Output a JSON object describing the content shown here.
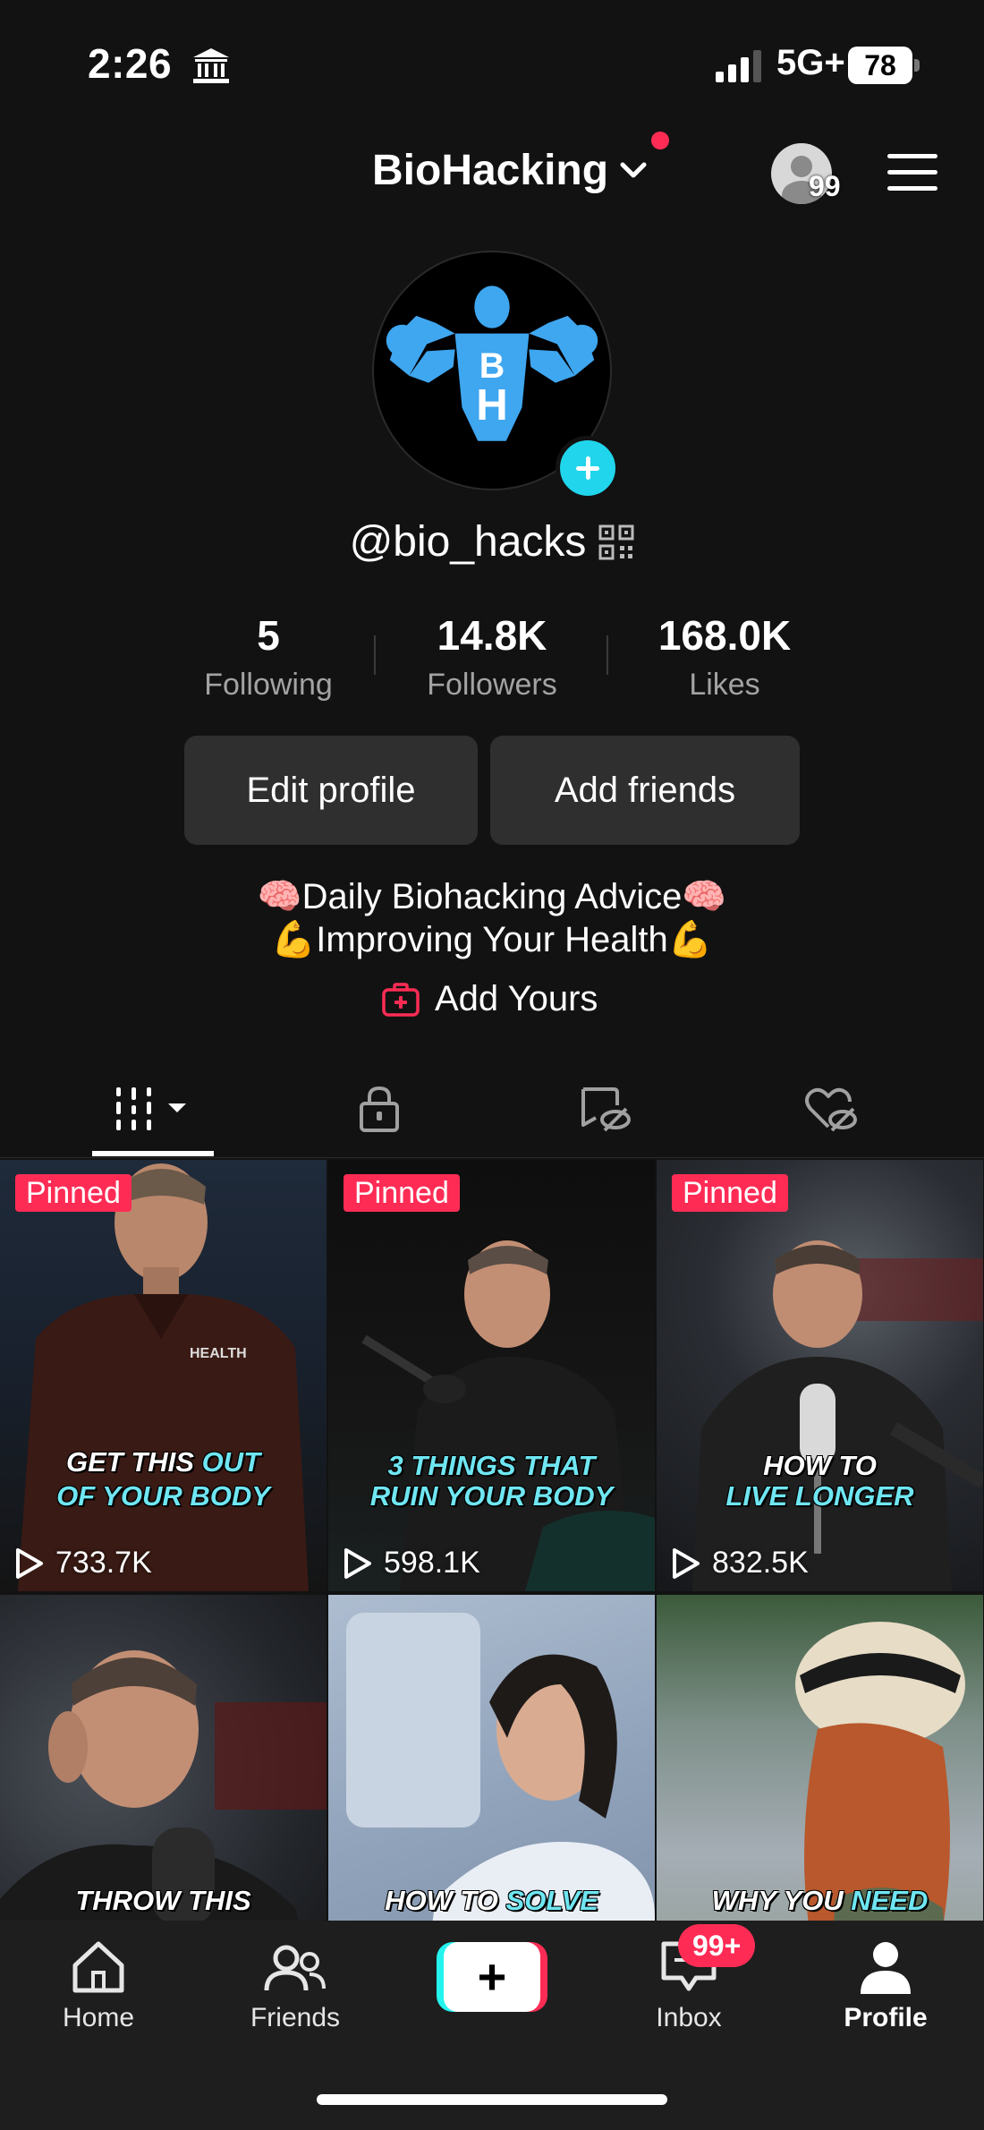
{
  "status_bar": {
    "time": "2:26",
    "network": "5G+",
    "battery": "78"
  },
  "header": {
    "account_name": "BioHacking",
    "visitors_count": "99"
  },
  "profile": {
    "username": "@bio_hacks",
    "avatar_letters": [
      "B",
      "H"
    ],
    "stats": [
      {
        "value": "5",
        "label": "Following"
      },
      {
        "value": "14.8K",
        "label": "Followers"
      },
      {
        "value": "168.0K",
        "label": "Likes"
      }
    ],
    "buttons": {
      "edit": "Edit profile",
      "add_friends": "Add friends"
    },
    "bio": {
      "line1": {
        "emoji_left": "🧠",
        "text": "Daily Biohacking Advice",
        "emoji_right": "🧠"
      },
      "line2": {
        "emoji_left": "💪",
        "text": "Improving Your Health",
        "emoji_right": "💪"
      }
    },
    "add_yours": "Add Yours"
  },
  "tabs": [
    "videos-grid-icon",
    "lock-icon",
    "hidden-repost-icon",
    "hidden-likes-icon"
  ],
  "videos": [
    {
      "pinned": "Pinned",
      "caption_l1": [
        "GET THIS ",
        "OUT"
      ],
      "caption_l2": [
        "OF YOUR BODY",
        ""
      ],
      "views": "733.7K",
      "brand": "HEALTH"
    },
    {
      "pinned": "Pinned",
      "caption_l1": [
        "3 THINGS THAT",
        ""
      ],
      "caption_l2": [
        "RUIN YOUR BODY",
        ""
      ],
      "views": "598.1K"
    },
    {
      "pinned": "Pinned",
      "caption_l1": [
        "HOW TO",
        ""
      ],
      "caption_l2": [
        "LIVE LONGER",
        ""
      ],
      "views": "832.5K"
    },
    {
      "caption_l1": [
        "THROW THIS",
        ""
      ]
    },
    {
      "caption_l1": [
        "HOW TO ",
        "SOLVE"
      ]
    },
    {
      "caption_l1": [
        "WHY YOU ",
        "NEED"
      ]
    }
  ],
  "bottom_nav": {
    "home": "Home",
    "friends": "Friends",
    "create": "+",
    "inbox": "Inbox",
    "inbox_badge": "99+",
    "profile": "Profile"
  },
  "colors": {
    "accent": "#fe2c55",
    "cyan": "#25f4ee",
    "avatar_blue": "#3fa6f0",
    "background": "#121212"
  }
}
